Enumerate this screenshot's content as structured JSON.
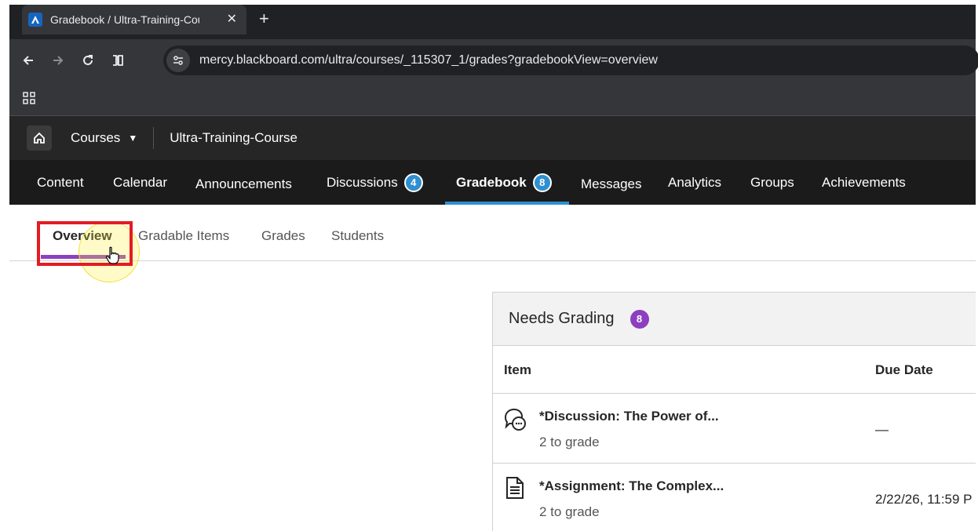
{
  "browser": {
    "tab_title": "Gradebook / Ultra-Training-Cou",
    "url": "mercy.blackboard.com/ultra/courses/_115307_1/grades?gradebookView=overview"
  },
  "header": {
    "courses_label": "Courses",
    "course_name": "Ultra-Training-Course"
  },
  "nav": {
    "content": "Content",
    "calendar": "Calendar",
    "announcements": "Announcements",
    "discussions": "Discussions",
    "discussions_count": "4",
    "gradebook": "Gradebook",
    "gradebook_count": "8",
    "messages": "Messages",
    "analytics": "Analytics",
    "groups": "Groups",
    "achievements": "Achievements"
  },
  "subtabs": {
    "overview": "Overview",
    "gradable_items": "Gradable Items",
    "grades": "Grades",
    "students": "Students"
  },
  "needs_grading": {
    "title": "Needs Grading",
    "count": "8",
    "col_item": "Item",
    "col_due": "Due Date",
    "rows": [
      {
        "icon": "discussion-icon",
        "title": "*Discussion: The Power of...",
        "sub": "2 to grade",
        "due": "—"
      },
      {
        "icon": "document-icon",
        "title": "*Assignment: The Complex...",
        "sub": "2 to grade",
        "due": "2/22/26, 11:59 P"
      }
    ]
  },
  "colors": {
    "nav_bg": "#1b1b1b",
    "header_bg": "#262626",
    "accent_blue": "#2f8fd0",
    "accent_purple": "#8c3fbf",
    "highlight_red": "#e31b23"
  }
}
